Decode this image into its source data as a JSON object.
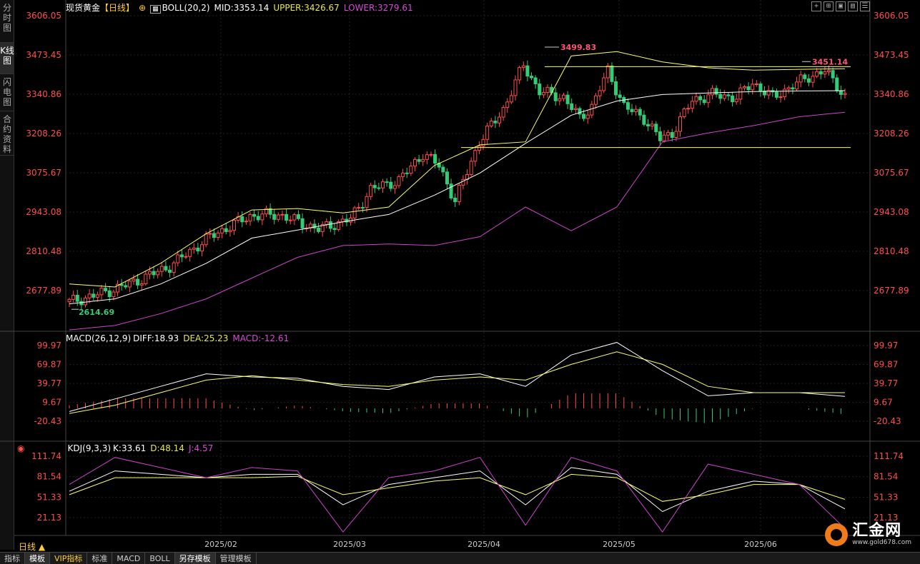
{
  "left_tabs": [
    {
      "label": "分时图",
      "active": false
    },
    {
      "label": "K线图",
      "active": true
    },
    {
      "label": "闪电图",
      "active": false
    },
    {
      "label": "合约资料",
      "active": false
    }
  ],
  "main_panel": {
    "instrument": "现货黄金",
    "period_tag": "【日线】",
    "indicator": "BOLL(20,2)",
    "mid": "MID:3353.14",
    "upper": "UPPER:3426.67",
    "lower": "LOWER:3279.61",
    "price_ticks": [
      "3606.05",
      "3473.45",
      "3340.86",
      "3208.26",
      "3075.67",
      "2943.08",
      "2810.48",
      "2677.89"
    ],
    "high_label": "3499.83",
    "recent_high_label": "3451.14",
    "low_label": "2614.69"
  },
  "macd_panel": {
    "indicator": "MACD(26,12,9)",
    "diff": "DIFF:18.93",
    "dea": "DEA:25.23",
    "macd": "MACD:-12.61",
    "ticks": [
      "99.97",
      "69.87",
      "39.77",
      "9.67",
      "-20.43"
    ]
  },
  "kdj_panel": {
    "indicator": "KDJ(9,3,3)",
    "k": "K:33.61",
    "d": "D:48.14",
    "j": "J:4.57",
    "ticks": [
      "111.74",
      "81.54",
      "51.33",
      "21.13"
    ]
  },
  "x_axis": [
    "2025/02",
    "2025/03",
    "2025/04",
    "2025/05",
    "2025/06"
  ],
  "period_button": "日线 ▲",
  "tool_icons": [
    "crosshair-icon",
    "zoom-icon",
    "layout-icon",
    "chart-icon",
    "settings-icon"
  ],
  "bottom_tabs": [
    {
      "label": "指标",
      "active": false,
      "vip": false
    },
    {
      "label": "模板",
      "active": true,
      "vip": false
    },
    {
      "label": "VIP指标",
      "active": false,
      "vip": true
    },
    {
      "label": "标准",
      "active": false,
      "vip": false
    },
    {
      "label": "MACD",
      "active": false,
      "vip": false
    },
    {
      "label": "BOLL",
      "active": false,
      "vip": false
    },
    {
      "label": "另存模板",
      "active": true,
      "vip": false
    },
    {
      "label": "管理模板",
      "active": false,
      "vip": false
    }
  ],
  "logo": {
    "name": "汇金网",
    "url": "www.gold678.com"
  },
  "colors": {
    "up": "#ff4d4d",
    "down": "#33cc77",
    "mid": "#ffffff",
    "upper": "#ffff66",
    "lower": "#cc44cc",
    "dea": "#ffff66",
    "axis_text": "#ff4d4d",
    "resistance": "#ffff66"
  },
  "chart_data": [
    {
      "type": "candlestick",
      "title": "现货黄金【日线】",
      "x": [
        "2025/02",
        "2025/03",
        "2025/04",
        "2025/05",
        "2025/06"
      ],
      "ylim": [
        2580,
        3620
      ],
      "annotations": [
        "3499.83",
        "3451.14",
        "2614.69"
      ],
      "horizontal_lines": [
        3434,
        3161
      ],
      "series": [
        {
          "name": "MID",
          "values": [
            2633,
            2650,
            2700,
            2770,
            2855,
            2882,
            2910,
            2935,
            3000,
            3075,
            3175,
            3270,
            3318,
            3340,
            3345,
            3350,
            3352,
            3353
          ]
        },
        {
          "name": "UPPER",
          "values": [
            2700,
            2690,
            2770,
            2870,
            2950,
            2955,
            2940,
            2960,
            3100,
            3170,
            3180,
            3470,
            3485,
            3450,
            3430,
            3422,
            3425,
            3427
          ]
        },
        {
          "name": "LOWER",
          "values": [
            2545,
            2560,
            2600,
            2650,
            2720,
            2790,
            2830,
            2835,
            2830,
            2860,
            2960,
            2880,
            2960,
            3180,
            3210,
            3235,
            3265,
            3280
          ]
        }
      ]
    },
    {
      "type": "line",
      "title": "MACD(26,12,9)",
      "ylim": [
        -40,
        115
      ],
      "series": [
        {
          "name": "DIFF",
          "values": [
            -5,
            15,
            35,
            55,
            50,
            48,
            35,
            30,
            50,
            55,
            35,
            85,
            105,
            60,
            20,
            25,
            25,
            19
          ]
        },
        {
          "name": "DEA",
          "values": [
            -8,
            5,
            25,
            45,
            52,
            45,
            38,
            35,
            45,
            50,
            45,
            70,
            90,
            70,
            35,
            25,
            25,
            25
          ]
        }
      ]
    },
    {
      "type": "line",
      "title": "KDJ(9,3,3)",
      "ylim": [
        -10,
        120
      ],
      "series": [
        {
          "name": "K",
          "values": [
            60,
            90,
            85,
            80,
            85,
            85,
            40,
            70,
            80,
            90,
            40,
            95,
            85,
            30,
            60,
            75,
            70,
            34
          ]
        },
        {
          "name": "D",
          "values": [
            55,
            80,
            80,
            80,
            80,
            82,
            55,
            65,
            75,
            80,
            55,
            85,
            80,
            45,
            55,
            70,
            70,
            48
          ]
        },
        {
          "name": "J",
          "values": [
            70,
            110,
            95,
            80,
            95,
            90,
            0,
            80,
            90,
            110,
            10,
            110,
            90,
            0,
            100,
            85,
            70,
            5
          ]
        }
      ]
    }
  ]
}
